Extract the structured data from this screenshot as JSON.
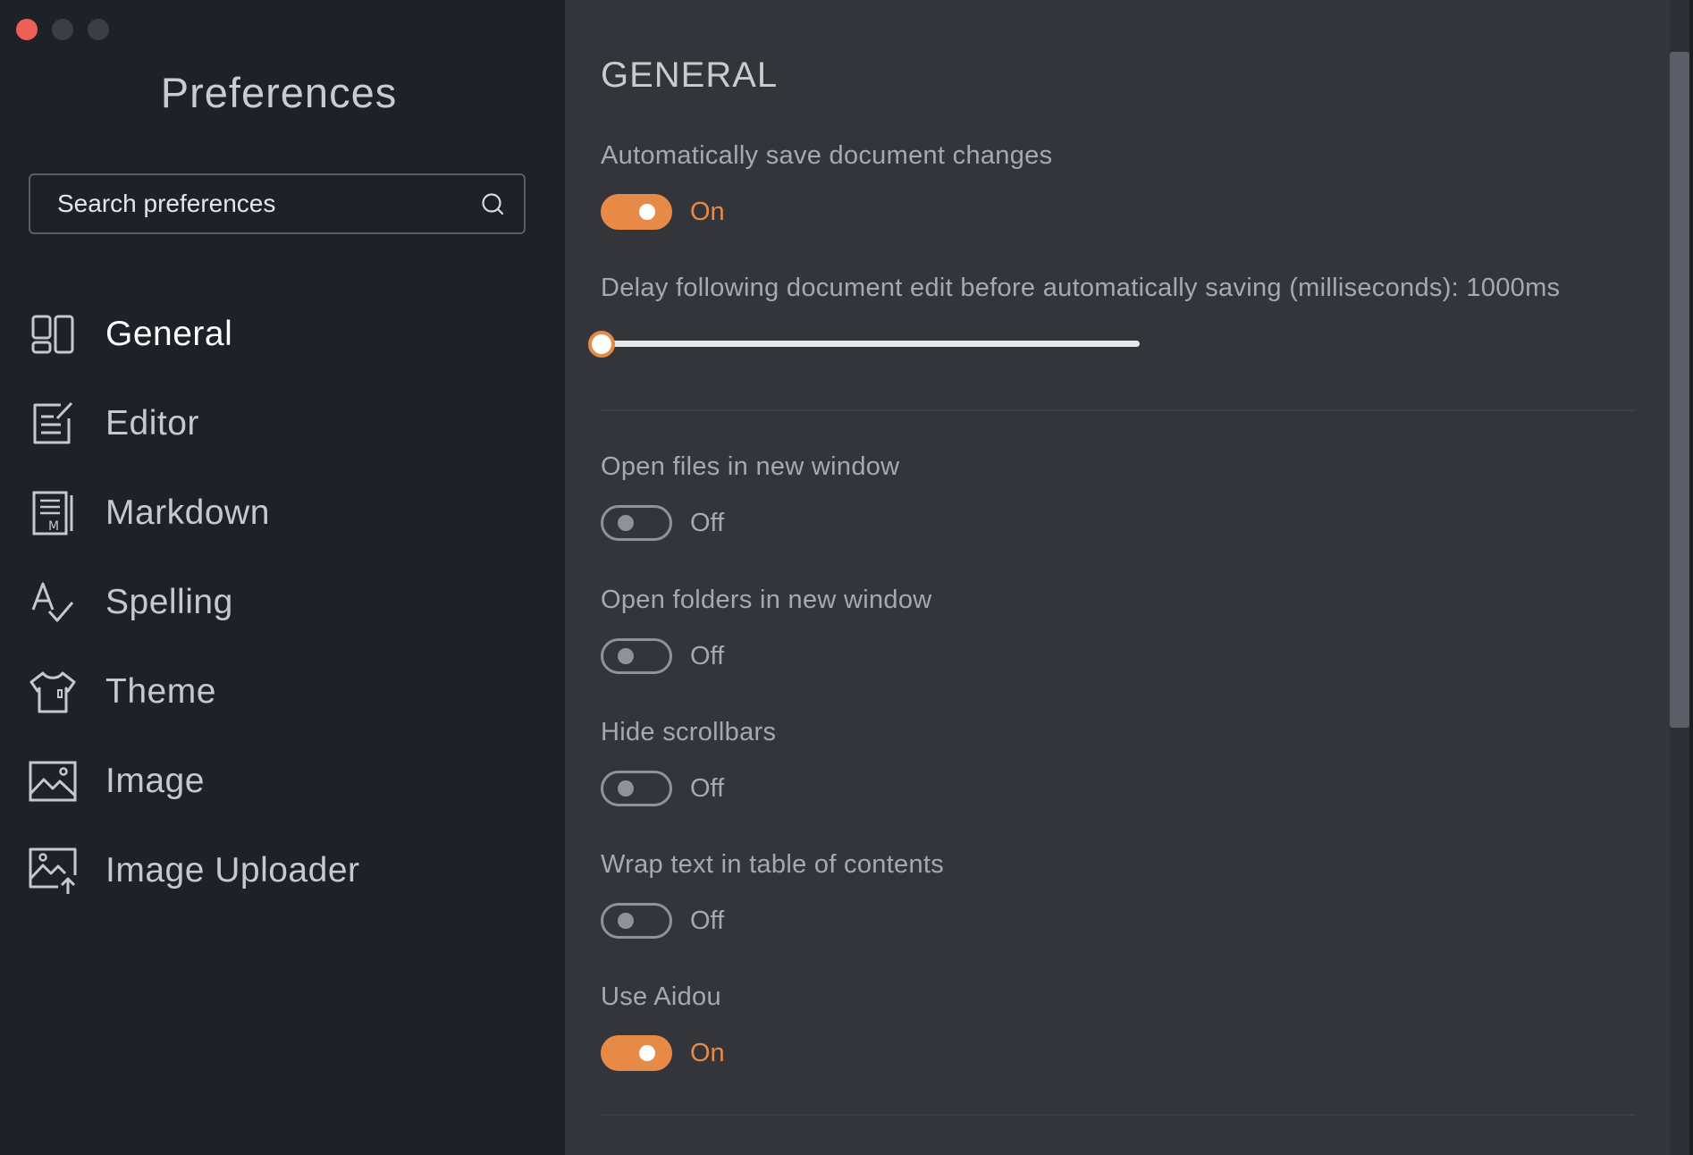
{
  "window": {
    "traffic_colors": [
      "#ee5f58",
      "#3c3e44",
      "#3c3e44"
    ]
  },
  "sidebar": {
    "title": "Preferences",
    "search": {
      "placeholder": "Search preferences",
      "icon": "search-icon"
    },
    "items": [
      {
        "label": "General",
        "icon": "general-icon",
        "active": true
      },
      {
        "label": "Editor",
        "icon": "editor-icon",
        "active": false
      },
      {
        "label": "Markdown",
        "icon": "markdown-icon",
        "active": false
      },
      {
        "label": "Spelling",
        "icon": "spelling-icon",
        "active": false
      },
      {
        "label": "Theme",
        "icon": "theme-icon",
        "active": false
      },
      {
        "label": "Image",
        "icon": "image-icon",
        "active": false
      },
      {
        "label": "Image Uploader",
        "icon": "image-uploader-icon",
        "active": false
      }
    ]
  },
  "main": {
    "section_title": "GENERAL",
    "settings": {
      "autosave": {
        "label": "Automatically save document changes",
        "state": "On"
      },
      "autosave_delay": {
        "label": "Delay following document edit before automatically saving (milliseconds): 1000ms",
        "value": 1000
      },
      "open_files_new_window": {
        "label": "Open files in new window",
        "state": "Off"
      },
      "open_folders_new_window": {
        "label": "Open folders in new window",
        "state": "Off"
      },
      "hide_scrollbars": {
        "label": "Hide scrollbars",
        "state": "Off"
      },
      "wrap_toc": {
        "label": "Wrap text in table of contents",
        "state": "Off"
      },
      "use_aidou": {
        "label": "Use Aidou",
        "state": "On"
      }
    }
  },
  "colors": {
    "accent": "#e88a47",
    "sidebar_bg": "#1f2128",
    "main_bg": "#33353b"
  }
}
